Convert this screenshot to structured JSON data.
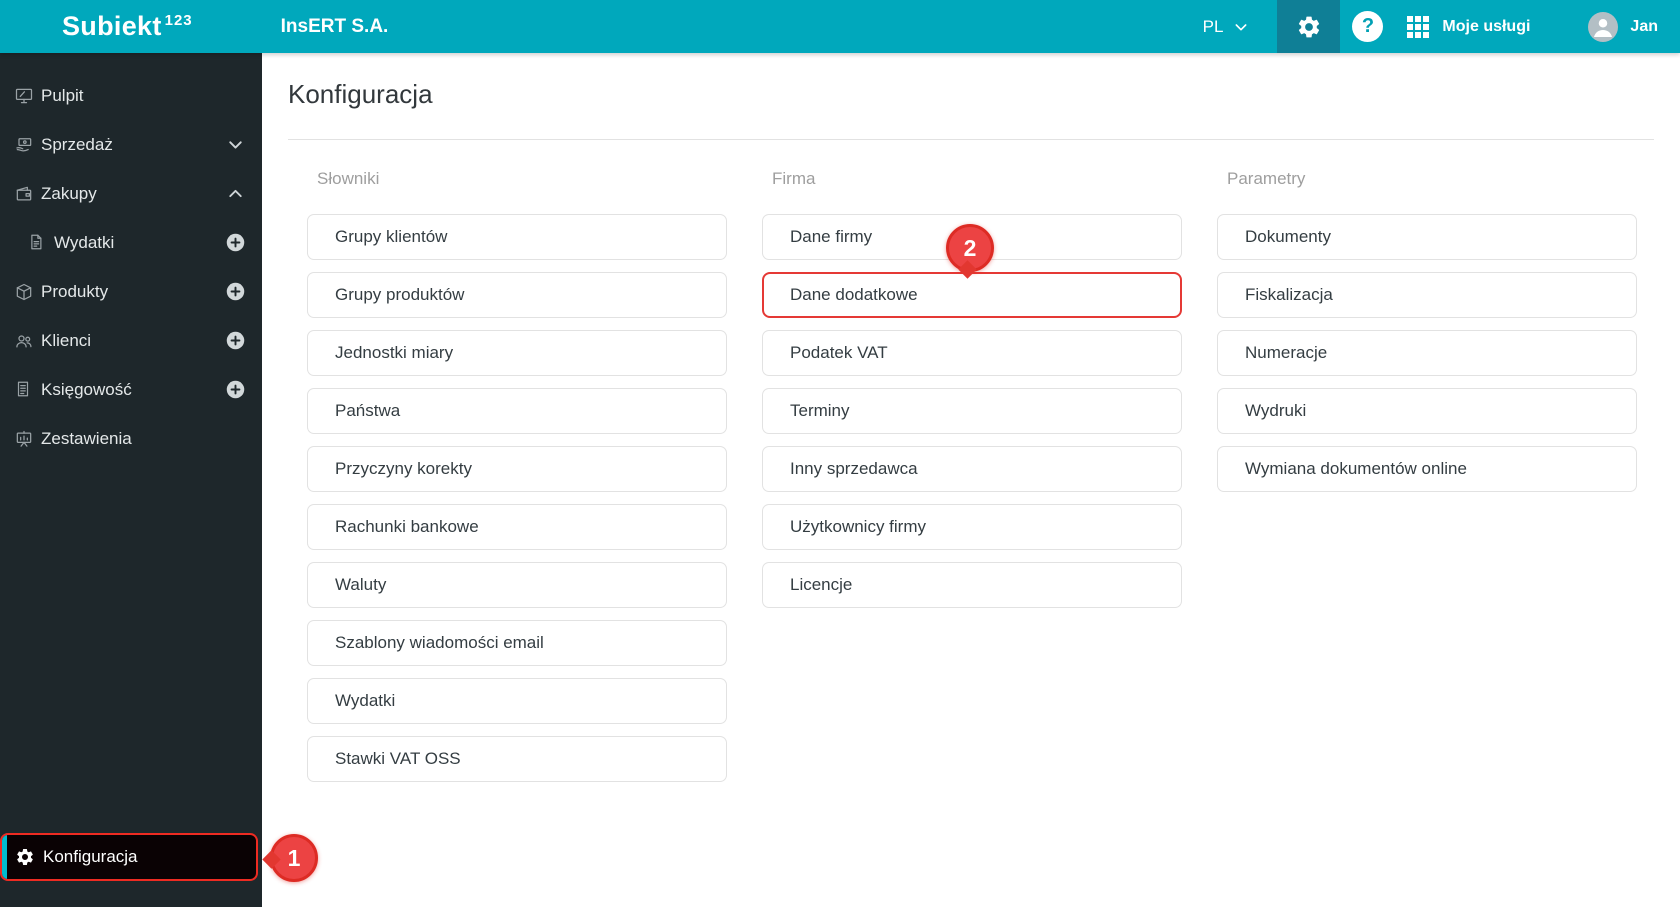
{
  "topbar": {
    "brand": "Subiekt",
    "brand_sup": "123",
    "company": "InsERT S.A.",
    "language": "PL",
    "help_glyph": "?",
    "services_label": "Moje usługi",
    "user_name": "Jan"
  },
  "sidebar": {
    "items": [
      {
        "label": "Pulpit"
      },
      {
        "label": "Sprzedaż"
      },
      {
        "label": "Zakupy"
      },
      {
        "label": "Wydatki"
      },
      {
        "label": "Produkty"
      },
      {
        "label": "Klienci"
      },
      {
        "label": "Księgowość"
      },
      {
        "label": "Zestawienia"
      }
    ],
    "bottom_item": {
      "label": "Konfiguracja"
    }
  },
  "main": {
    "title": "Konfiguracja",
    "columns": [
      {
        "header": "Słowniki",
        "items": [
          "Grupy klientów",
          "Grupy produktów",
          "Jednostki miary",
          "Państwa",
          "Przyczyny korekty",
          "Rachunki bankowe",
          "Waluty",
          "Szablony wiadomości email",
          "Wydatki",
          "Stawki VAT OSS"
        ]
      },
      {
        "header": "Firma",
        "items": [
          "Dane firmy",
          "Dane dodatkowe",
          "Podatek VAT",
          "Terminy",
          "Inny sprzedawca",
          "Użytkownicy firmy",
          "Licencje"
        ]
      },
      {
        "header": "Parametry",
        "items": [
          "Dokumenty",
          "Fiskalizacja",
          "Numeracje",
          "Wydruki",
          "Wymiana dokumentów online"
        ]
      }
    ]
  },
  "annotations": {
    "step_1": "1",
    "step_2": "2"
  },
  "colors": {
    "topbar_teal": "#00a8bc",
    "topbar_active_teal": "#0f7f96",
    "sidebar_dark": "#1e272b",
    "annotation_red": "#e53935",
    "active_strip_teal": "#00bccf"
  }
}
